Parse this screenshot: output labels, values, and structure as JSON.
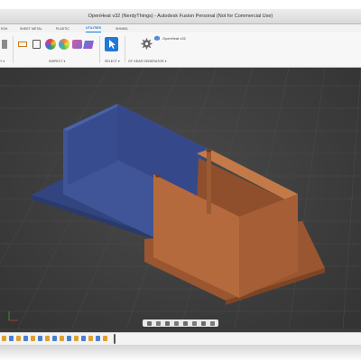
{
  "window": {
    "title": "OpenHeat v32 (NerdyThings) - Autodesk Fusion Personal (Not for Commercial Use)"
  },
  "workspace_tabs": [
    {
      "label": "ESH",
      "active": false
    },
    {
      "label": "SHEET METAL",
      "active": false
    },
    {
      "label": "PLASTIC",
      "active": false
    },
    {
      "label": "UTILITIES",
      "active": true
    },
    {
      "label": "SHNKEL",
      "active": false
    }
  ],
  "toolbar_groups": {
    "left_partial": "Y ▾",
    "inspect": "INSPECT ▾",
    "select": "SELECT ▾",
    "gear": "GF GEAR GENERATOR ▾"
  },
  "document": {
    "tab_label": "OpenHeat v32"
  },
  "colors": {
    "blue_body": "#3f5597",
    "orange_body": "#b56a3d",
    "viewport_bg": "#3e3e3e",
    "accent": "#1f7ad6"
  },
  "icons": {
    "navbar": [
      "orbit-icon",
      "pan-icon",
      "look-at-icon",
      "zoom-icon",
      "fit-icon",
      "display-icon",
      "grid-icon",
      "viewport-icon"
    ]
  }
}
